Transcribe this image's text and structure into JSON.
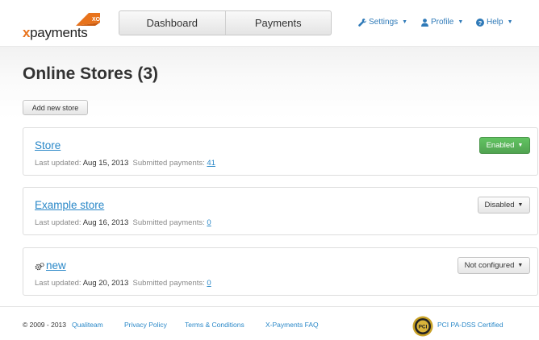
{
  "logo": {
    "prefix": "x",
    "word": "payments",
    "badge": "XO"
  },
  "nav": {
    "tabs": [
      "Dashboard",
      "Payments"
    ]
  },
  "top_menu": {
    "settings": "Settings",
    "profile": "Profile",
    "help": "Help"
  },
  "main": {
    "title": "Online Stores (3)",
    "add_button": "Add new store",
    "last_updated_label": "Last updated:",
    "submitted_label": "Submitted payments:",
    "stores": [
      {
        "name": "Store",
        "date": "Aug 15, 2013",
        "payments": "41",
        "status": "Enabled"
      },
      {
        "name": "Example store",
        "date": "Aug 16, 2013",
        "payments": "0",
        "status": "Disabled"
      },
      {
        "name": "new",
        "date": "Aug 20, 2013",
        "payments": "0",
        "status": "Not configured"
      }
    ]
  },
  "footer": {
    "copyright": "© 2009 - 2013",
    "links": [
      "Qualiteam",
      "Privacy Policy",
      "Terms & Conditions",
      "X-Payments FAQ"
    ],
    "pci_badge": "PCI",
    "pci_text": "PCI PA-DSS Certified"
  },
  "colors": {
    "accent": "#e8731c",
    "link": "#2a88c8",
    "enabled": "#5bb75b"
  }
}
